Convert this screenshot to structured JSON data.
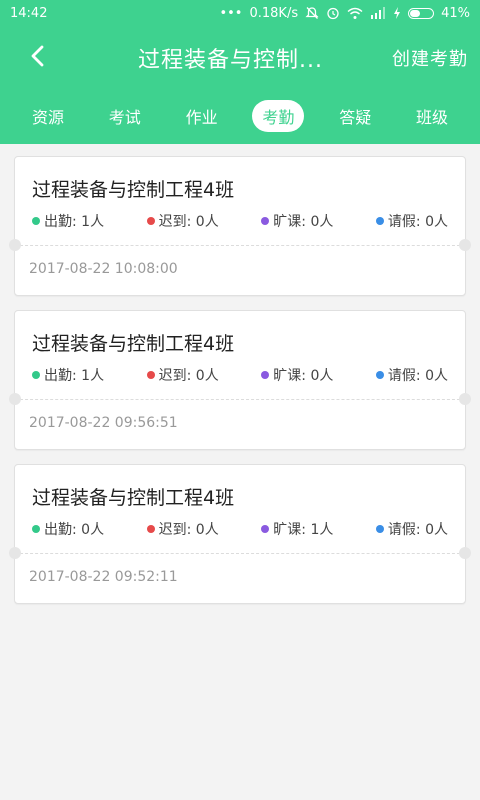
{
  "status_bar": {
    "time": "14:42",
    "net_speed": "0.18K/s",
    "battery": "41%"
  },
  "header": {
    "title": "过程装备与控制...",
    "action": "创建考勤"
  },
  "tabs": [
    {
      "label": "资源"
    },
    {
      "label": "考试"
    },
    {
      "label": "作业"
    },
    {
      "label": "考勤"
    },
    {
      "label": "答疑"
    },
    {
      "label": "班级"
    }
  ],
  "active_tab": "考勤",
  "colors": {
    "primary": "#3ed28f",
    "present": "#33c98a",
    "late": "#e64a4a",
    "absent": "#8a5ae0",
    "leave": "#3a8ee6"
  },
  "records": [
    {
      "class_name": "过程装备与控制工程4班",
      "present": "出勤: 1人",
      "late": "迟到: 0人",
      "absent": "旷课: 0人",
      "leave": "请假: 0人",
      "time": "2017-08-22 10:08:00"
    },
    {
      "class_name": "过程装备与控制工程4班",
      "present": "出勤: 1人",
      "late": "迟到: 0人",
      "absent": "旷课: 0人",
      "leave": "请假: 0人",
      "time": "2017-08-22 09:56:51"
    },
    {
      "class_name": "过程装备与控制工程4班",
      "present": "出勤: 0人",
      "late": "迟到: 0人",
      "absent": "旷课: 1人",
      "leave": "请假: 0人",
      "time": "2017-08-22 09:52:11"
    }
  ]
}
